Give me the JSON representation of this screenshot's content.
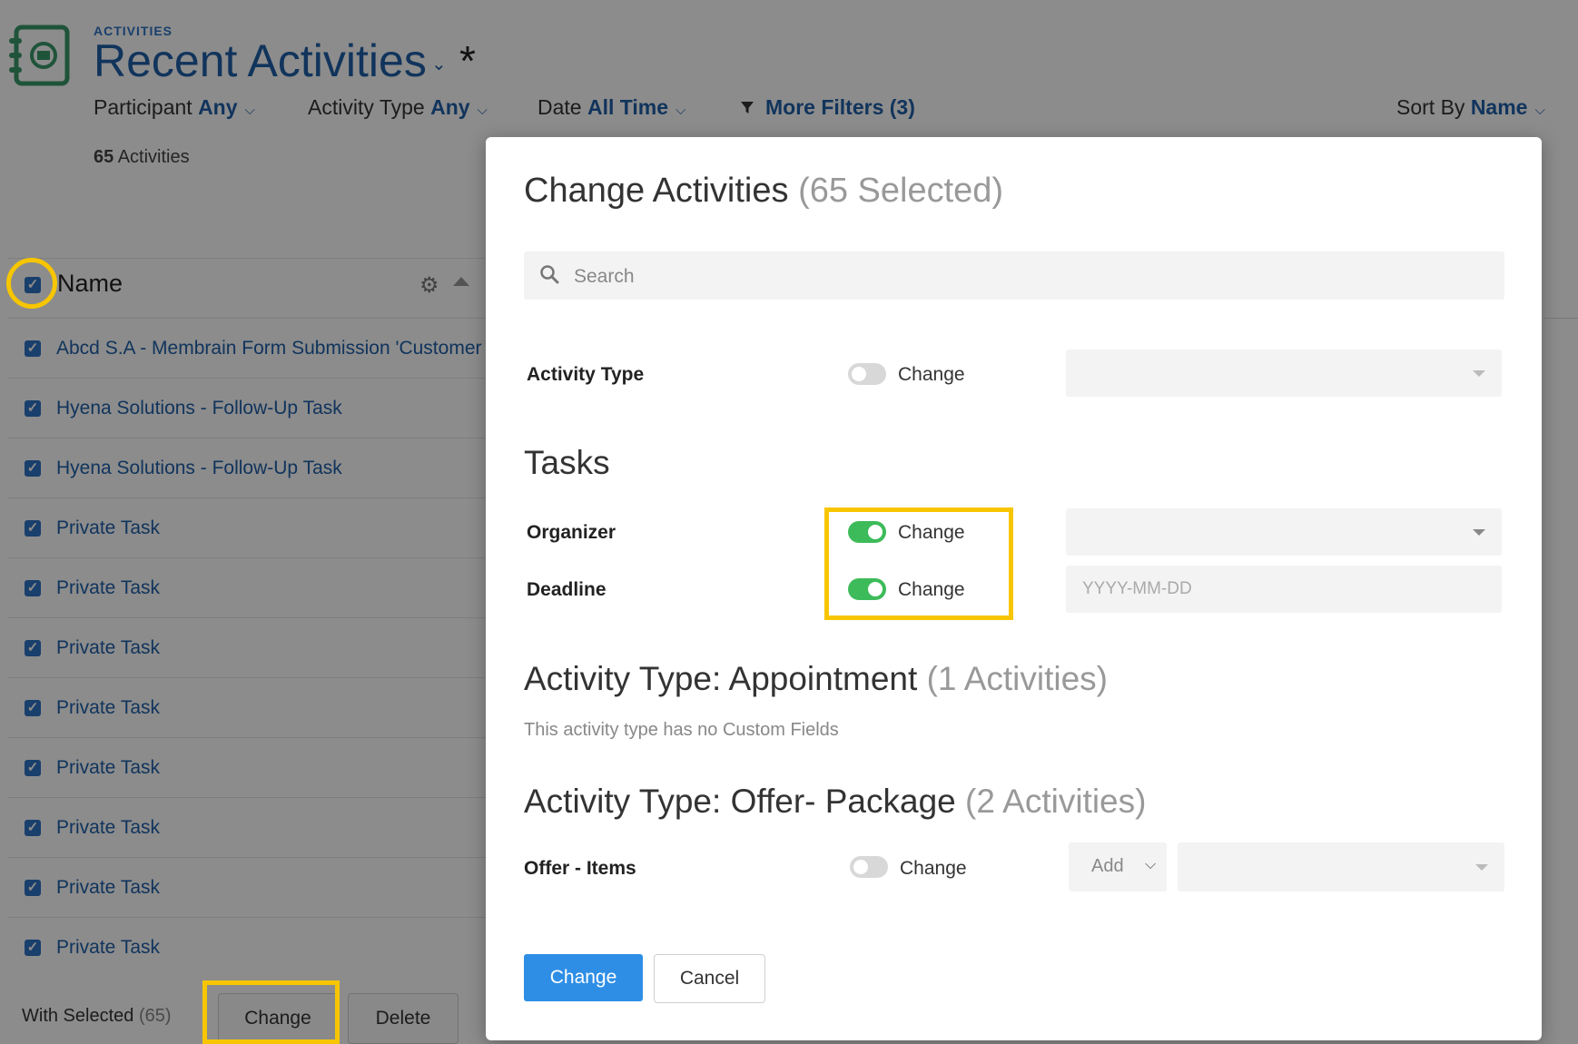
{
  "header": {
    "section_label": "ACTIVITIES",
    "title": "Recent Activities",
    "title_caret_icon": "chevron-down-icon",
    "unsaved_mark": "*"
  },
  "filters": {
    "participant": {
      "label": "Participant",
      "value": "Any"
    },
    "activity_type": {
      "label": "Activity Type",
      "value": "Any"
    },
    "date": {
      "label": "Date",
      "value": "All Time"
    },
    "more_filters": "More Filters (3)",
    "sort_by": {
      "label": "Sort By",
      "value": "Name"
    }
  },
  "list": {
    "count": "65",
    "count_suffix": "Activities",
    "name_header": "Name",
    "rows": [
      "Abcd S.A - Membrain Form Submission 'Customer Sa",
      "Hyena Solutions - Follow-Up Task",
      "Hyena Solutions - Follow-Up Task",
      "Private Task",
      "Private Task",
      "Private Task",
      "Private Task",
      "Private Task",
      "Private Task",
      "Private Task",
      "Private Task"
    ]
  },
  "bulk": {
    "with_selected": "With Selected",
    "selected_count": "(65)",
    "change_label": "Change",
    "delete_label": "Delete"
  },
  "modal": {
    "title": "Change Activities",
    "title_count": "(65 Selected)",
    "search_placeholder": "Search",
    "activity_type_label": "Activity Type",
    "toggle_change_label": "Change",
    "tasks_heading": "Tasks",
    "organizer_label": "Organizer",
    "deadline_label": "Deadline",
    "deadline_placeholder": "YYYY-MM-DD",
    "appointment_heading": "Activity Type: Appointment",
    "appointment_count": "(1 Activities)",
    "appointment_note": "This activity type has no Custom Fields",
    "offer_heading": "Activity Type: Offer- Package",
    "offer_count": "(2 Activities)",
    "offer_items_label": "Offer - Items",
    "add_option": "Add",
    "change_button": "Change",
    "cancel_button": "Cancel",
    "toggles": {
      "activity_type": false,
      "organizer": true,
      "deadline": true,
      "offer_items": false
    }
  },
  "colors": {
    "accent": "#2f73c5",
    "primary_button": "#2e8ee6",
    "toggle_on": "#3dbb5a",
    "highlight": "#f7c600"
  }
}
